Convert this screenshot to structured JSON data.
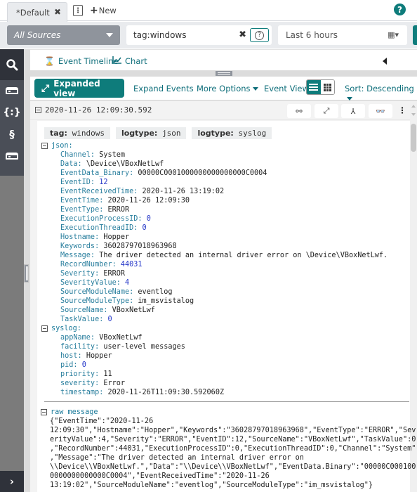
{
  "tabs": [
    {
      "label": "*Default",
      "close_icon": "close-icon"
    }
  ],
  "tab_menu_icon": "kebab-icon",
  "new_tab": {
    "plus": "+",
    "label": "New"
  },
  "help_icon": "?",
  "search": {
    "source_selector": "All Sources",
    "query_value": "tag:windows",
    "clear_icon": "✖",
    "query_help": "?",
    "time_range": "Last 6 hours",
    "calendar_icon": "▦▾"
  },
  "sidebar": {
    "items": [
      {
        "name": "search",
        "glyph": "Q"
      },
      {
        "name": "sources",
        "glyph": ""
      },
      {
        "name": "parsers",
        "glyph": "{:}"
      },
      {
        "name": "scripts",
        "glyph": "§"
      },
      {
        "name": "storage",
        "glyph": ""
      }
    ],
    "expand_glyph": "›"
  },
  "viewbar": {
    "event_timeline": "Event Timeline",
    "timeline_icon": "⌛",
    "chart": "Chart",
    "chart_icon": "📈"
  },
  "results_toolbar": {
    "expanded_view": "Expanded view",
    "expanded_icon": "⤢",
    "expand_events": "Expand Events",
    "more_options": "More Options",
    "event_view": "Event View",
    "sort": "Sort: Descending"
  },
  "event": {
    "timestamp": "2020-11-26 12:09:30.592",
    "actions": {
      "link": "⚯",
      "expand": "⤢",
      "tree": "⅄",
      "find": "👓",
      "more": "⋮"
    },
    "tags": [
      {
        "key": "tag:",
        "value": "windows"
      },
      {
        "key": "logtype:",
        "value": "json"
      },
      {
        "key": "logtype:",
        "value": "syslog"
      }
    ],
    "json_label": "json:",
    "json_fields": [
      {
        "k": "Channel:",
        "v": "System",
        "num": false
      },
      {
        "k": "Data:",
        "v": "\\Device\\VBoxNetLwf",
        "num": false
      },
      {
        "k": "EventData_Binary:",
        "v": "00000C0001000000000000000C0004",
        "num": false
      },
      {
        "k": "EventID:",
        "v": "12",
        "num": true
      },
      {
        "k": "EventReceivedTime:",
        "v": "2020-11-26 13:19:02",
        "num": false
      },
      {
        "k": "EventTime:",
        "v": "2020-11-26 12:09:30",
        "num": false
      },
      {
        "k": "EventType:",
        "v": "ERROR",
        "num": false
      },
      {
        "k": "ExecutionProcessID:",
        "v": "0",
        "num": true
      },
      {
        "k": "ExecutionThreadID:",
        "v": "0",
        "num": true
      },
      {
        "k": "Hostname:",
        "v": "Hopper",
        "num": false
      },
      {
        "k": "Keywords:",
        "v": "36028797018963968",
        "num": false
      },
      {
        "k": "Message:",
        "v": "The driver detected an internal driver error on \\Device\\VBoxNetLwf.",
        "num": false
      },
      {
        "k": "RecordNumber:",
        "v": "44031",
        "num": true
      },
      {
        "k": "Severity:",
        "v": "ERROR",
        "num": false
      },
      {
        "k": "SeverityValue:",
        "v": "4",
        "num": true
      },
      {
        "k": "SourceModuleName:",
        "v": "eventlog",
        "num": false
      },
      {
        "k": "SourceModuleType:",
        "v": "im_msvistalog",
        "num": false
      },
      {
        "k": "SourceName:",
        "v": "VBoxNetLwf",
        "num": false
      },
      {
        "k": "TaskValue:",
        "v": "0",
        "num": true
      }
    ],
    "syslog_label": "syslog:",
    "syslog_fields": [
      {
        "k": "appName:",
        "v": "VBoxNetLwf",
        "num": false
      },
      {
        "k": "facility:",
        "v": "user-level messages",
        "num": false
      },
      {
        "k": "host:",
        "v": "Hopper",
        "num": false
      },
      {
        "k": "pid:",
        "v": "0",
        "num": true
      },
      {
        "k": "priority:",
        "v": "11",
        "num": false
      },
      {
        "k": "severity:",
        "v": "Error",
        "num": false
      },
      {
        "k": "timestamp:",
        "v": "2020-11-26T11:09:30.592060Z",
        "num": false
      }
    ],
    "raw_label": "raw message",
    "raw_lines": [
      "{\"EventTime\":\"2020-11-26",
      "12:09:30\",\"Hostname\":\"Hopper\",\"Keywords\":\"36028797018963968\",\"EventType\":\"ERROR\",\"Sev",
      "erityValue\":4,\"Severity\":\"ERROR\",\"EventID\":12,\"SourceName\":\"VBoxNetLwf\",\"TaskValue\":0",
      ",\"RecordNumber\":44031,\"ExecutionProcessID\":0,\"ExecutionThreadID\":0,\"Channel\":\"System\"",
      ",\"Message\":\"The driver detected an internal driver error on",
      "\\\\Device\\\\VBoxNetLwf.\",\"Data\":\"\\\\Device\\\\VBoxNetLwf\",\"EventData.Binary\":\"00000C000100",
      "0000000000000C0004\",\"EventReceivedTime\":\"2020-11-26",
      "13:19:02\",\"SourceModuleName\":\"eventlog\",\"SourceModuleType\":\"im_msvistalog\"}"
    ]
  }
}
